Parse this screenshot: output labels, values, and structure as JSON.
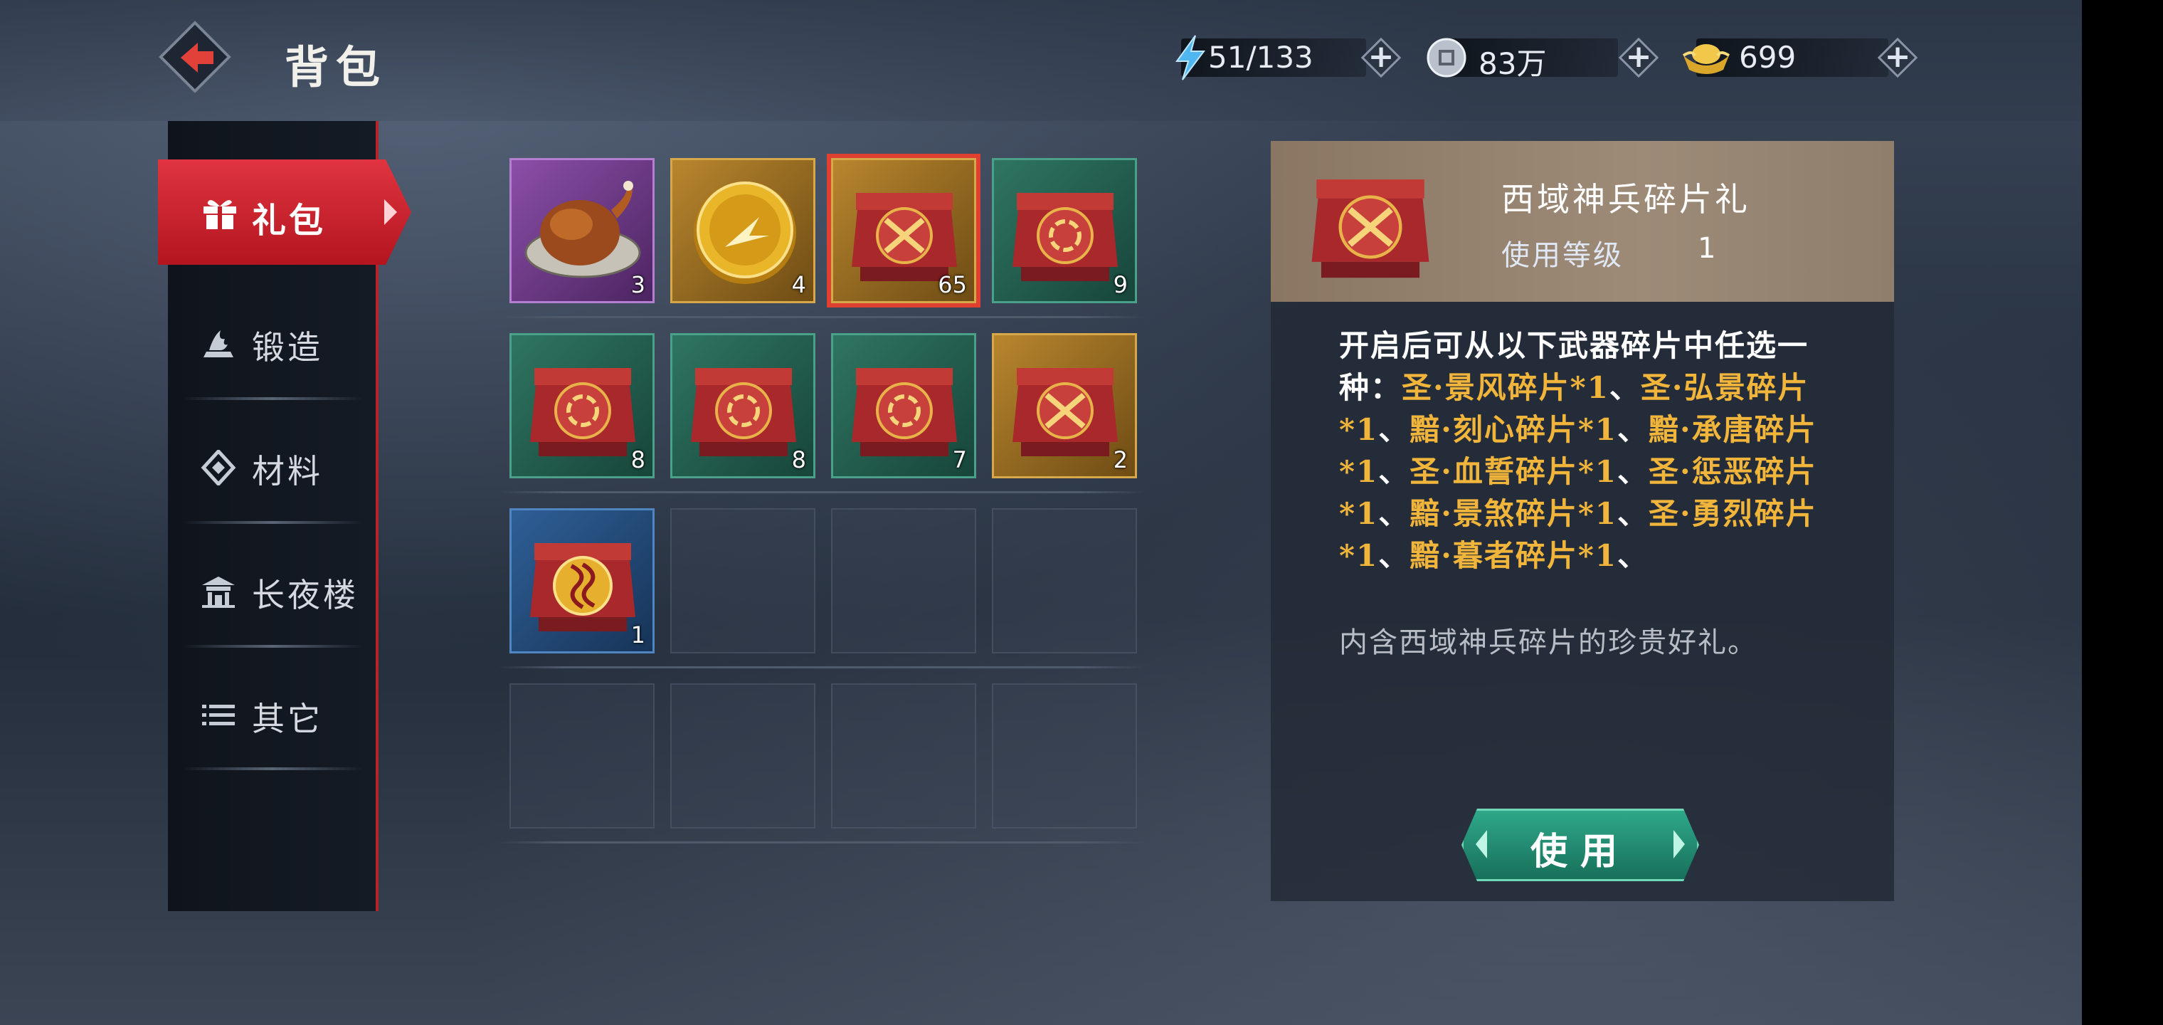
{
  "header": {
    "title": "背包",
    "energy": "51/133",
    "silver": "83万",
    "gold": "699"
  },
  "nav": {
    "items": [
      {
        "label": "礼包",
        "icon": "gift-icon",
        "active": true
      },
      {
        "label": "锻造",
        "icon": "forge-icon"
      },
      {
        "label": "材料",
        "icon": "material-icon"
      },
      {
        "label": "长夜楼",
        "icon": "pavilion-icon"
      },
      {
        "label": "其它",
        "icon": "list-icon"
      }
    ]
  },
  "inventory": {
    "items": [
      {
        "name": "roast-chicken",
        "count": "3",
        "rarity": "purple"
      },
      {
        "name": "gold-token",
        "count": "4",
        "rarity": "gold"
      },
      {
        "name": "weapon-shard-chest",
        "count": "65",
        "rarity": "gold",
        "selected": true
      },
      {
        "name": "swirl-chest",
        "count": "9",
        "rarity": "green"
      },
      {
        "name": "swirl-chest",
        "count": "8",
        "rarity": "green"
      },
      {
        "name": "swirl-chest",
        "count": "8",
        "rarity": "green"
      },
      {
        "name": "swirl-chest",
        "count": "7",
        "rarity": "green"
      },
      {
        "name": "weapon-shard-chest",
        "count": "2",
        "rarity": "gold"
      },
      {
        "name": "gold-swirl-chest",
        "count": "1",
        "rarity": "blue"
      }
    ]
  },
  "detail": {
    "name": "西域神兵碎片礼",
    "level_label": "使用等级",
    "level_value": "1",
    "desc_intro": "开启后可从以下武器碎片中任选一种：",
    "desc_options": [
      "圣·景风碎片*1",
      "圣·弘景碎片*1",
      "黯·刻心碎片*1",
      "黯·承唐碎片*1",
      "圣·血誓碎片*1",
      "圣·惩恶碎片*1",
      "黯·景煞碎片*1",
      "圣·勇烈碎片*1",
      "黯·暮者碎片*1"
    ],
    "separator": "、",
    "flavor": "内含西域神兵碎片的珍贵好礼。",
    "use_label": "使用"
  },
  "colors": {
    "accent_red": "#d92a34",
    "highlight_gold": "#f0b53a",
    "use_green": "#1f8a6e"
  }
}
